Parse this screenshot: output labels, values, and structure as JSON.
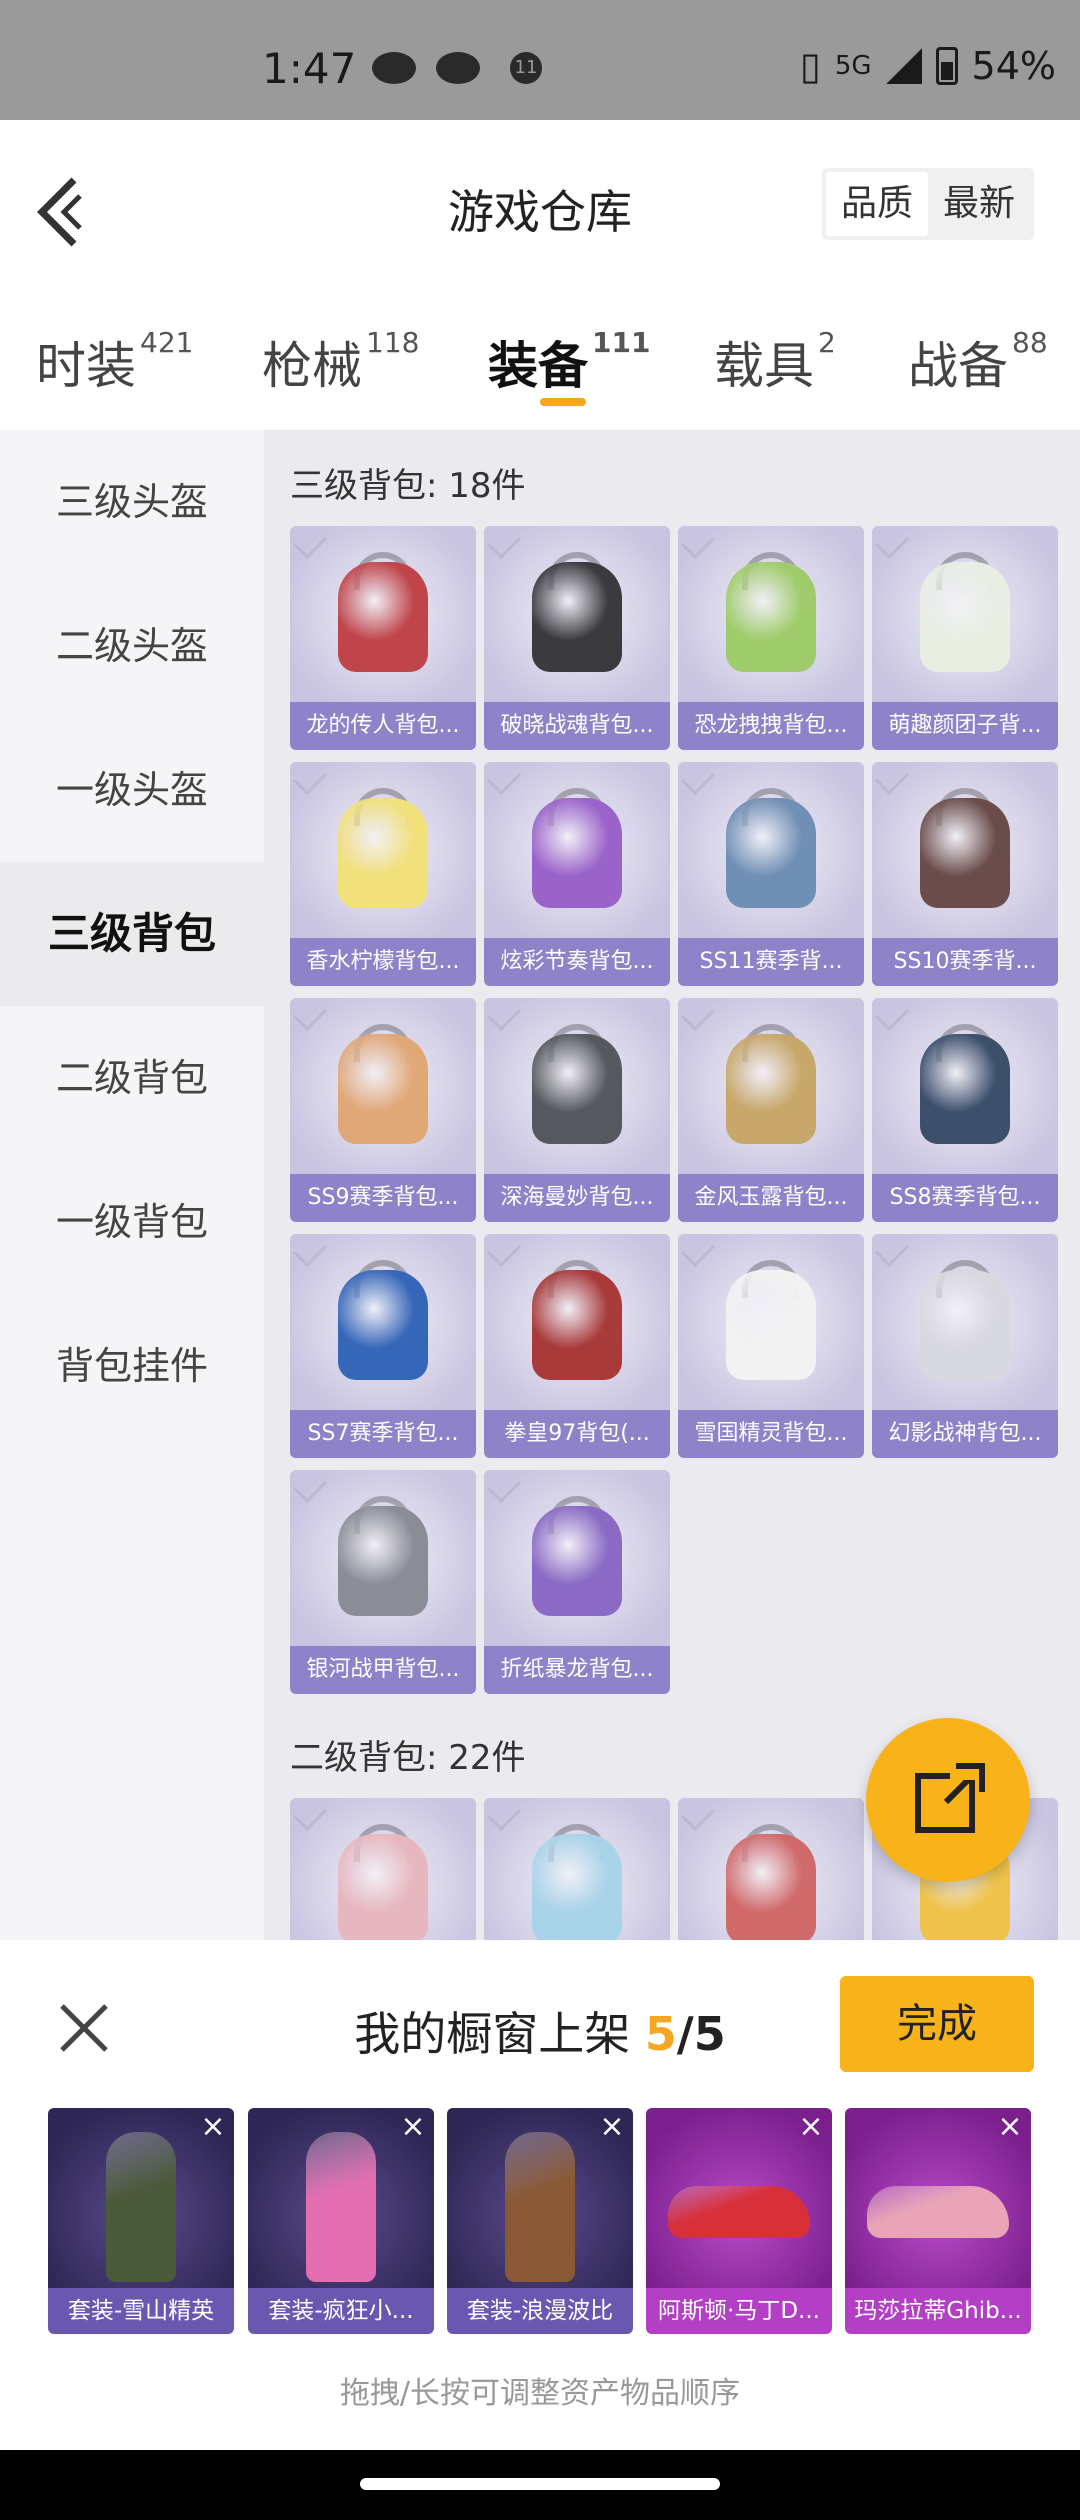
{
  "status_bar": {
    "time": "1:47",
    "network": "5G",
    "battery": "54%",
    "notif_count": "11"
  },
  "header": {
    "title": "游戏仓库",
    "sort_quality": "品质",
    "sort_newest": "最新"
  },
  "tabs": [
    {
      "label": "时装",
      "count": "421"
    },
    {
      "label": "枪械",
      "count": "118"
    },
    {
      "label": "装备",
      "count": "111"
    },
    {
      "label": "载具",
      "count": "2"
    },
    {
      "label": "战备",
      "count": "88"
    }
  ],
  "sidebar": [
    {
      "label": "三级头盔"
    },
    {
      "label": "二级头盔"
    },
    {
      "label": "一级头盔"
    },
    {
      "label": "三级背包"
    },
    {
      "label": "二级背包"
    },
    {
      "label": "一级背包"
    },
    {
      "label": "背包挂件"
    }
  ],
  "sections": [
    {
      "title": "三级背包: 18件",
      "items": [
        {
          "name": "龙的传人背包...",
          "color": "#c0454b"
        },
        {
          "name": "破晓战魂背包...",
          "color": "#3a3a3f"
        },
        {
          "name": "恐龙拽拽背包...",
          "color": "#9fcc6a"
        },
        {
          "name": "萌趣颜团子背...",
          "color": "#e8efe2"
        },
        {
          "name": "香水柠檬背包...",
          "color": "#f2e07a"
        },
        {
          "name": "炫彩节奏背包...",
          "color": "#9a63c9"
        },
        {
          "name": "SS11赛季背...",
          "color": "#6f8fb4"
        },
        {
          "name": "SS10赛季背...",
          "color": "#6a4d4a"
        },
        {
          "name": "SS9赛季背包...",
          "color": "#e0a777"
        },
        {
          "name": "深海曼妙背包...",
          "color": "#55585e"
        },
        {
          "name": "金风玉露背包...",
          "color": "#c7a76a"
        },
        {
          "name": "SS8赛季背包...",
          "color": "#3c4f6b"
        },
        {
          "name": "SS7赛季背包...",
          "color": "#3566b8"
        },
        {
          "name": "拳皇97背包(...",
          "color": "#a83a3a"
        },
        {
          "name": "雪国精灵背包...",
          "color": "#f2f2f2"
        },
        {
          "name": "幻影战神背包...",
          "color": "#d8d8df"
        },
        {
          "name": "银河战甲背包...",
          "color": "#8a8d97"
        },
        {
          "name": "折纸暴龙背包...",
          "color": "#8a6ac4"
        }
      ]
    },
    {
      "title": "二级背包: 22件",
      "items": [
        {
          "name": "",
          "color": "#e7b7bf"
        },
        {
          "name": "",
          "color": "#a9d3e8"
        },
        {
          "name": "",
          "color": "#d06a6a"
        },
        {
          "name": "",
          "color": "#efc34a"
        }
      ]
    }
  ],
  "showcase": {
    "title_prefix": "我的橱窗上架",
    "current": "5",
    "separator": "/",
    "max": "5",
    "done_label": "完成",
    "hint": "拖拽/长按可调整资产物品顺序",
    "items": [
      {
        "name": "套装-雪山精英",
        "style": "purple",
        "color": "#4b5a3a"
      },
      {
        "name": "套装-疯狂小...",
        "style": "purple",
        "color": "#e36fb0"
      },
      {
        "name": "套装-浪漫波比",
        "style": "purple",
        "color": "#8a5a36"
      },
      {
        "name": "阿斯顿·马丁D...",
        "style": "pink",
        "color": "#d8303a"
      },
      {
        "name": "玛莎拉蒂Ghib...",
        "style": "pink",
        "color": "#e9a4b8"
      }
    ]
  }
}
